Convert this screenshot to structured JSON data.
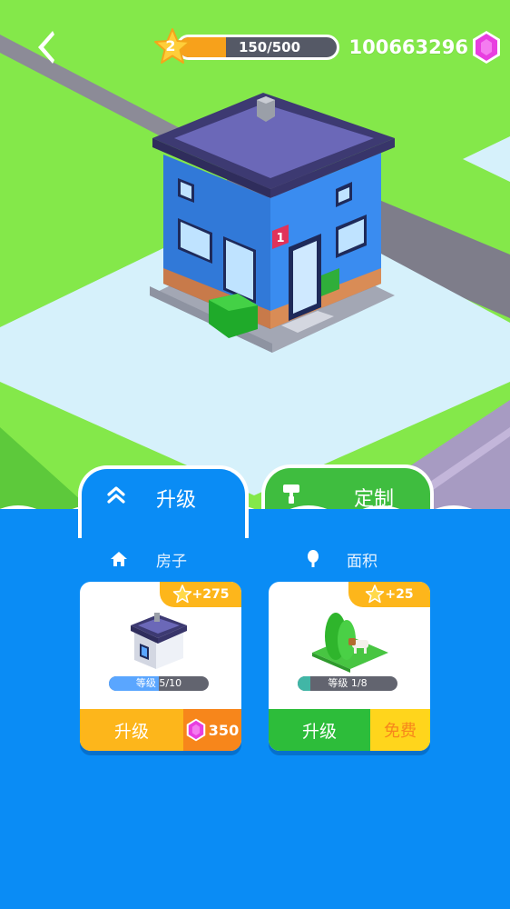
{
  "header": {
    "level": "2",
    "xp_text": "150/500",
    "xp_progress": 0.3,
    "gems": "100663296"
  },
  "building": {
    "house_number": "1"
  },
  "tabs": [
    {
      "label": "升级",
      "icon": "double-chevron-up-icon",
      "active": true
    },
    {
      "label": "定制",
      "icon": "paint-roller-icon",
      "active": false
    }
  ],
  "sections": {
    "house_title": "房子",
    "area_title": "面积"
  },
  "cards": {
    "house": {
      "bonus": "+275",
      "level_text": "等级 5/10",
      "level_progress": 0.5,
      "button_label": "升级",
      "price": "350"
    },
    "area": {
      "bonus": "+25",
      "level_text": "等级 1/8",
      "level_progress": 0.125,
      "button_label": "升级",
      "price": "免费"
    }
  },
  "colors": {
    "panel_blue": "#0a8cf5",
    "grass": "#84e84a",
    "orange": "#fdb61b",
    "green_button": "#2dbd3a",
    "gem_pink": "#e83ee0"
  }
}
